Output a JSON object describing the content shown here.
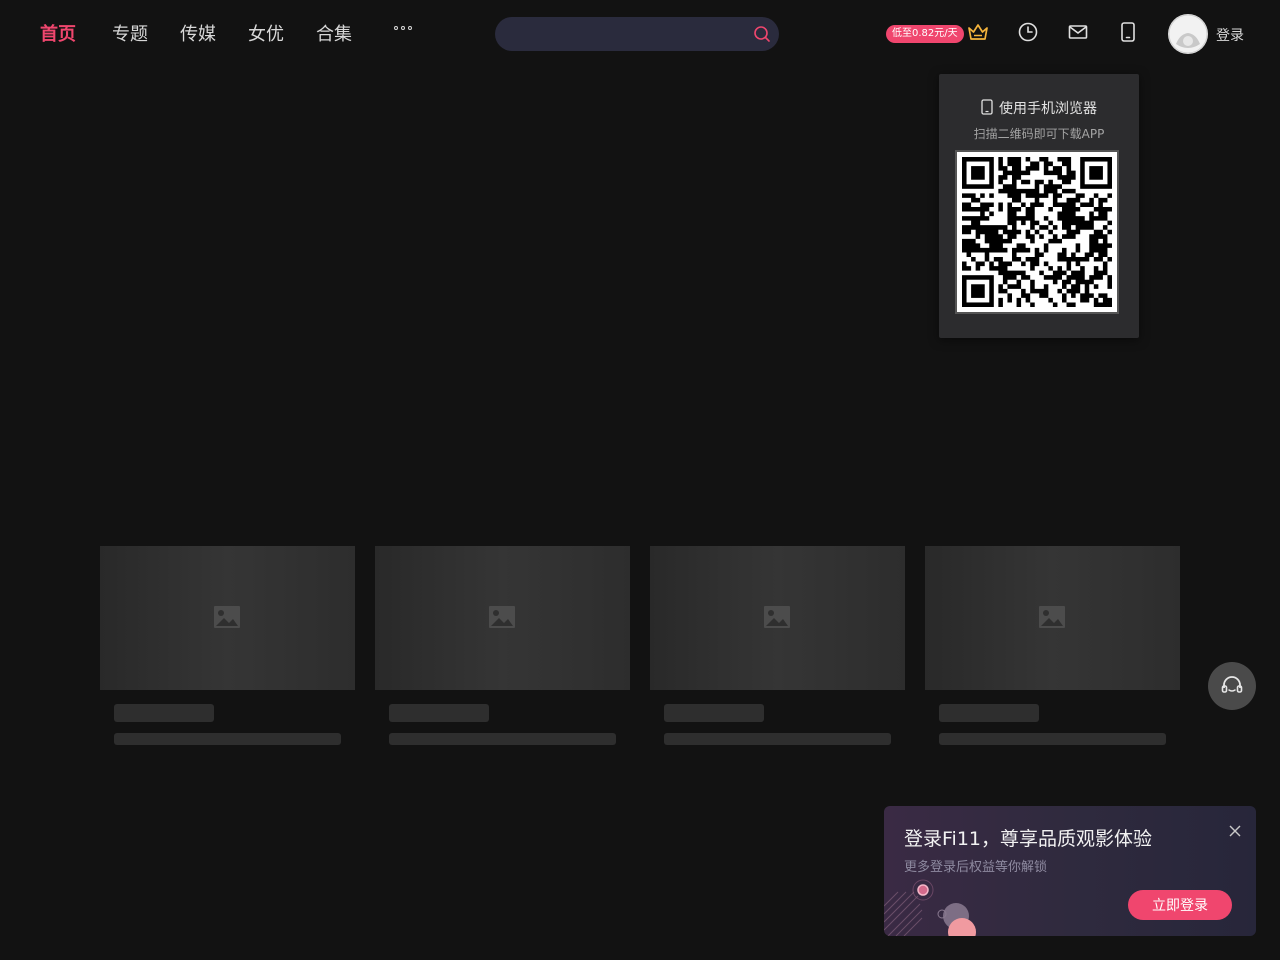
{
  "nav": {
    "items": [
      {
        "label": "首页",
        "active": true
      },
      {
        "label": "专题"
      },
      {
        "label": "传媒"
      },
      {
        "label": "女优"
      },
      {
        "label": "合集"
      }
    ],
    "more_icon": "more-dots-icon"
  },
  "search": {
    "placeholder": "",
    "value": "",
    "icon": "search-icon"
  },
  "header": {
    "promo_badge": "低至0.82元/天",
    "icons": [
      "crown-icon",
      "history-icon",
      "mail-icon",
      "phone-icon"
    ],
    "login_label": "登录"
  },
  "qr_popup": {
    "title": "使用手机浏览器",
    "subtitle": "扫描二维码即可下载APP"
  },
  "login_popup": {
    "title": "登录Fi11，尊享品质观影体验",
    "subtitle": "更多登录后权益等你解锁",
    "button_label": "立即登录"
  },
  "colors": {
    "accent": "#f0466e",
    "background": "#121212",
    "search_bg": "#2a2b3d",
    "skeleton": "#2e2e2e"
  }
}
